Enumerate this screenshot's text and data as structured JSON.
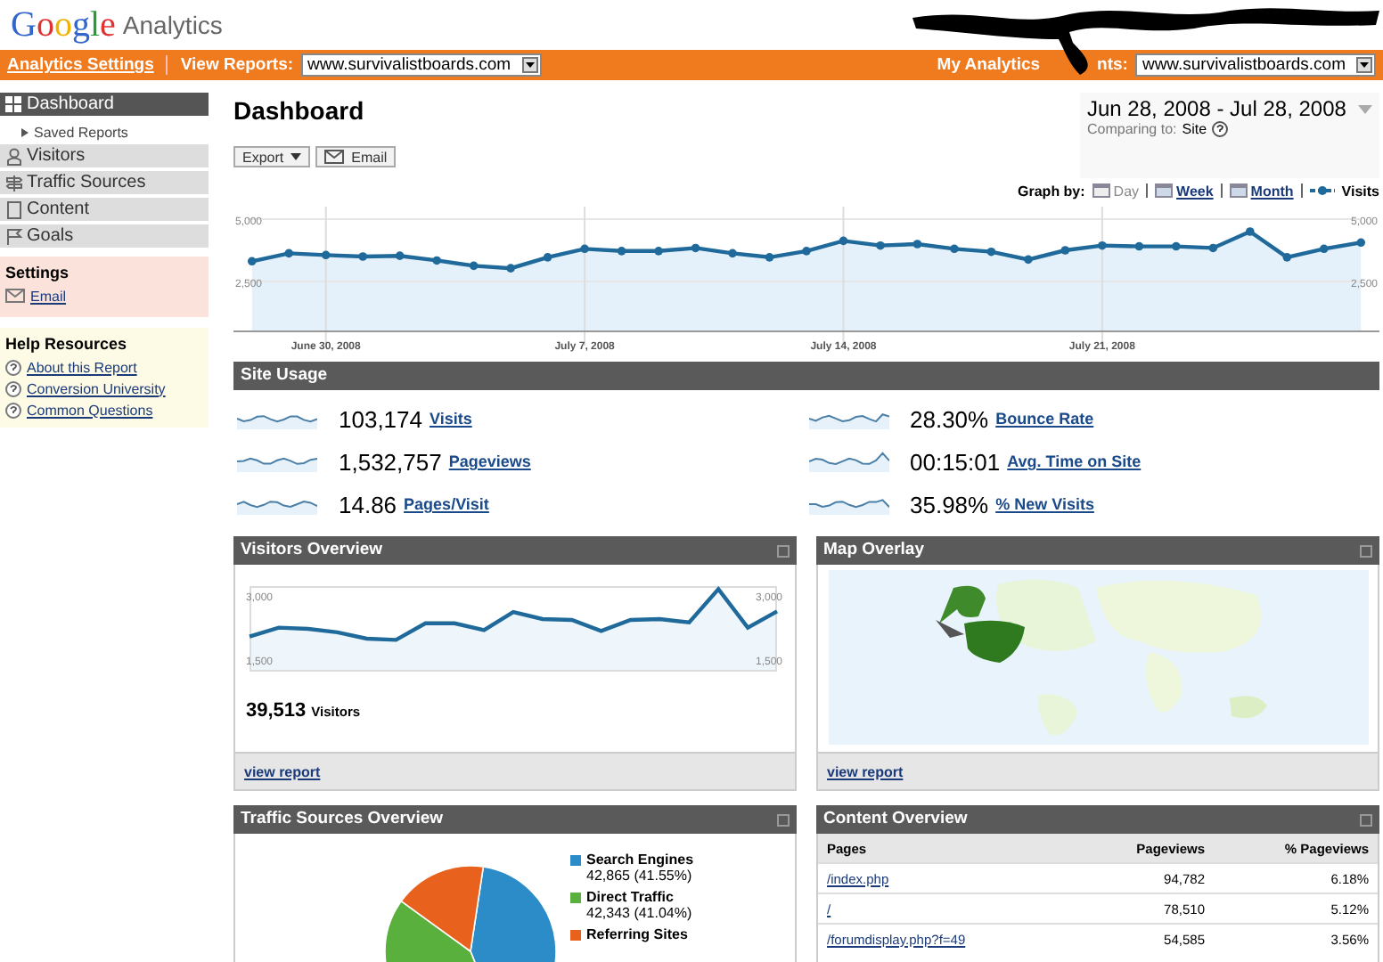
{
  "header": {
    "logo": "Google",
    "product": "Analytics"
  },
  "toolbar": {
    "settings_link": "Analytics Settings",
    "view_reports_label": "View Reports:",
    "view_reports_value": "www.survivalistboards.com",
    "accounts_label_start": "My Analytics",
    "accounts_label_end": "nts:",
    "accounts_value": "www.survivalistboards.com"
  },
  "sidebar": {
    "nav": [
      {
        "label": "Dashboard",
        "selected": true,
        "children": [
          {
            "label": "Saved Reports"
          }
        ]
      },
      {
        "label": "Visitors",
        "selected": false
      },
      {
        "label": "Traffic Sources",
        "selected": false
      },
      {
        "label": "Content",
        "selected": false
      },
      {
        "label": "Goals",
        "selected": false
      }
    ],
    "settings": {
      "title": "Settings",
      "links": [
        "Email"
      ]
    },
    "help": {
      "title": "Help Resources",
      "links": [
        "About this Report",
        "Conversion University",
        "Common Questions"
      ]
    }
  },
  "main": {
    "title": "Dashboard",
    "date_range": "Jun 28, 2008 - Jul 28, 2008",
    "comparing_label": "Comparing to:",
    "comparing_value": "Site",
    "export": "Export",
    "email": "Email",
    "graph_by_label": "Graph by:",
    "graph_options": [
      {
        "label": "Day",
        "selected": true
      },
      {
        "label": "Week",
        "selected": false
      },
      {
        "label": "Month",
        "selected": false
      }
    ],
    "chart_data": {
      "type": "area",
      "grid": true,
      "ylim": [
        500,
        5500
      ],
      "yticks": [
        {
          "value": 2500,
          "label": "2,500"
        },
        {
          "value": 5000,
          "label": "5,000"
        }
      ],
      "categories": [
        null,
        null,
        "June 30, 2008",
        null,
        null,
        null,
        null,
        null,
        null,
        "July 7, 2008",
        null,
        null,
        null,
        null,
        null,
        null,
        "July 14, 2008",
        null,
        null,
        null,
        null,
        null,
        null,
        "July 21, 2008",
        null,
        null,
        null,
        null,
        null,
        null,
        null
      ],
      "series": [
        {
          "name": "Visits",
          "color": "#1f6a9a",
          "marker": true,
          "values": [
            3310,
            3630,
            3560,
            3500,
            3530,
            3340,
            3130,
            3030,
            3470,
            3810,
            3720,
            3720,
            3840,
            3630,
            3470,
            3720,
            4130,
            3940,
            4000,
            3810,
            3690,
            3380,
            3750,
            3940,
            3910,
            3910,
            3840,
            4500,
            3470,
            3810,
            4060
          ]
        }
      ]
    }
  },
  "site_usage": {
    "title": "Site Usage",
    "metrics": [
      {
        "value": "103,174",
        "label": "Visits"
      },
      {
        "value": "28.30%",
        "label": "Bounce Rate"
      },
      {
        "value": "1,532,757",
        "label": "Pageviews"
      },
      {
        "value": "00:15:01",
        "label": "Avg. Time on Site"
      },
      {
        "value": "14.86",
        "label": "Pages/Visit"
      },
      {
        "value": "35.98%",
        "label": "% New Visits"
      }
    ]
  },
  "visitors_overview": {
    "title": "Visitors Overview",
    "count": "39,513",
    "count_label": "Visitors",
    "link": "view report",
    "chart_data": {
      "type": "area",
      "ylim": [
        1200,
        3200
      ],
      "yticks": [
        {
          "value": 1500,
          "label": "1,500"
        },
        {
          "value": 3000,
          "label": "3,000"
        }
      ],
      "series": [
        {
          "color": "#1f6a9a",
          "values": [
            2020,
            2230,
            2200,
            2120,
            1970,
            1940,
            2330,
            2330,
            2170,
            2590,
            2430,
            2410,
            2150,
            2410,
            2430,
            2350,
            3130,
            2230,
            2610
          ]
        }
      ]
    }
  },
  "map_overlay": {
    "title": "Map Overlay",
    "link": "view report"
  },
  "traffic_sources": {
    "title": "Traffic Sources Overview",
    "chart_data": {
      "type": "pie",
      "categories": [
        "Search Engines",
        "Direct Traffic",
        "Referring Sites"
      ],
      "values": [
        41.55,
        41.04,
        17.41
      ]
    },
    "legend": [
      {
        "detail": "42,865 (41.55%)",
        "color": "#2b8cc8"
      },
      {
        "detail": "42,343 (41.04%)",
        "color": "#5ab03c"
      },
      {
        "color": "#e8621e"
      }
    ]
  },
  "content_overview": {
    "title": "Content Overview",
    "columns": [
      "Pages",
      "Pageviews",
      "% Pageviews"
    ],
    "rows": [
      [
        "/index.php",
        "94,782",
        "6.18%"
      ],
      [
        "/",
        "78,510",
        "5.12%"
      ],
      [
        "/forumdisplay.php?f=49",
        "54,585",
        "3.56%"
      ]
    ]
  }
}
